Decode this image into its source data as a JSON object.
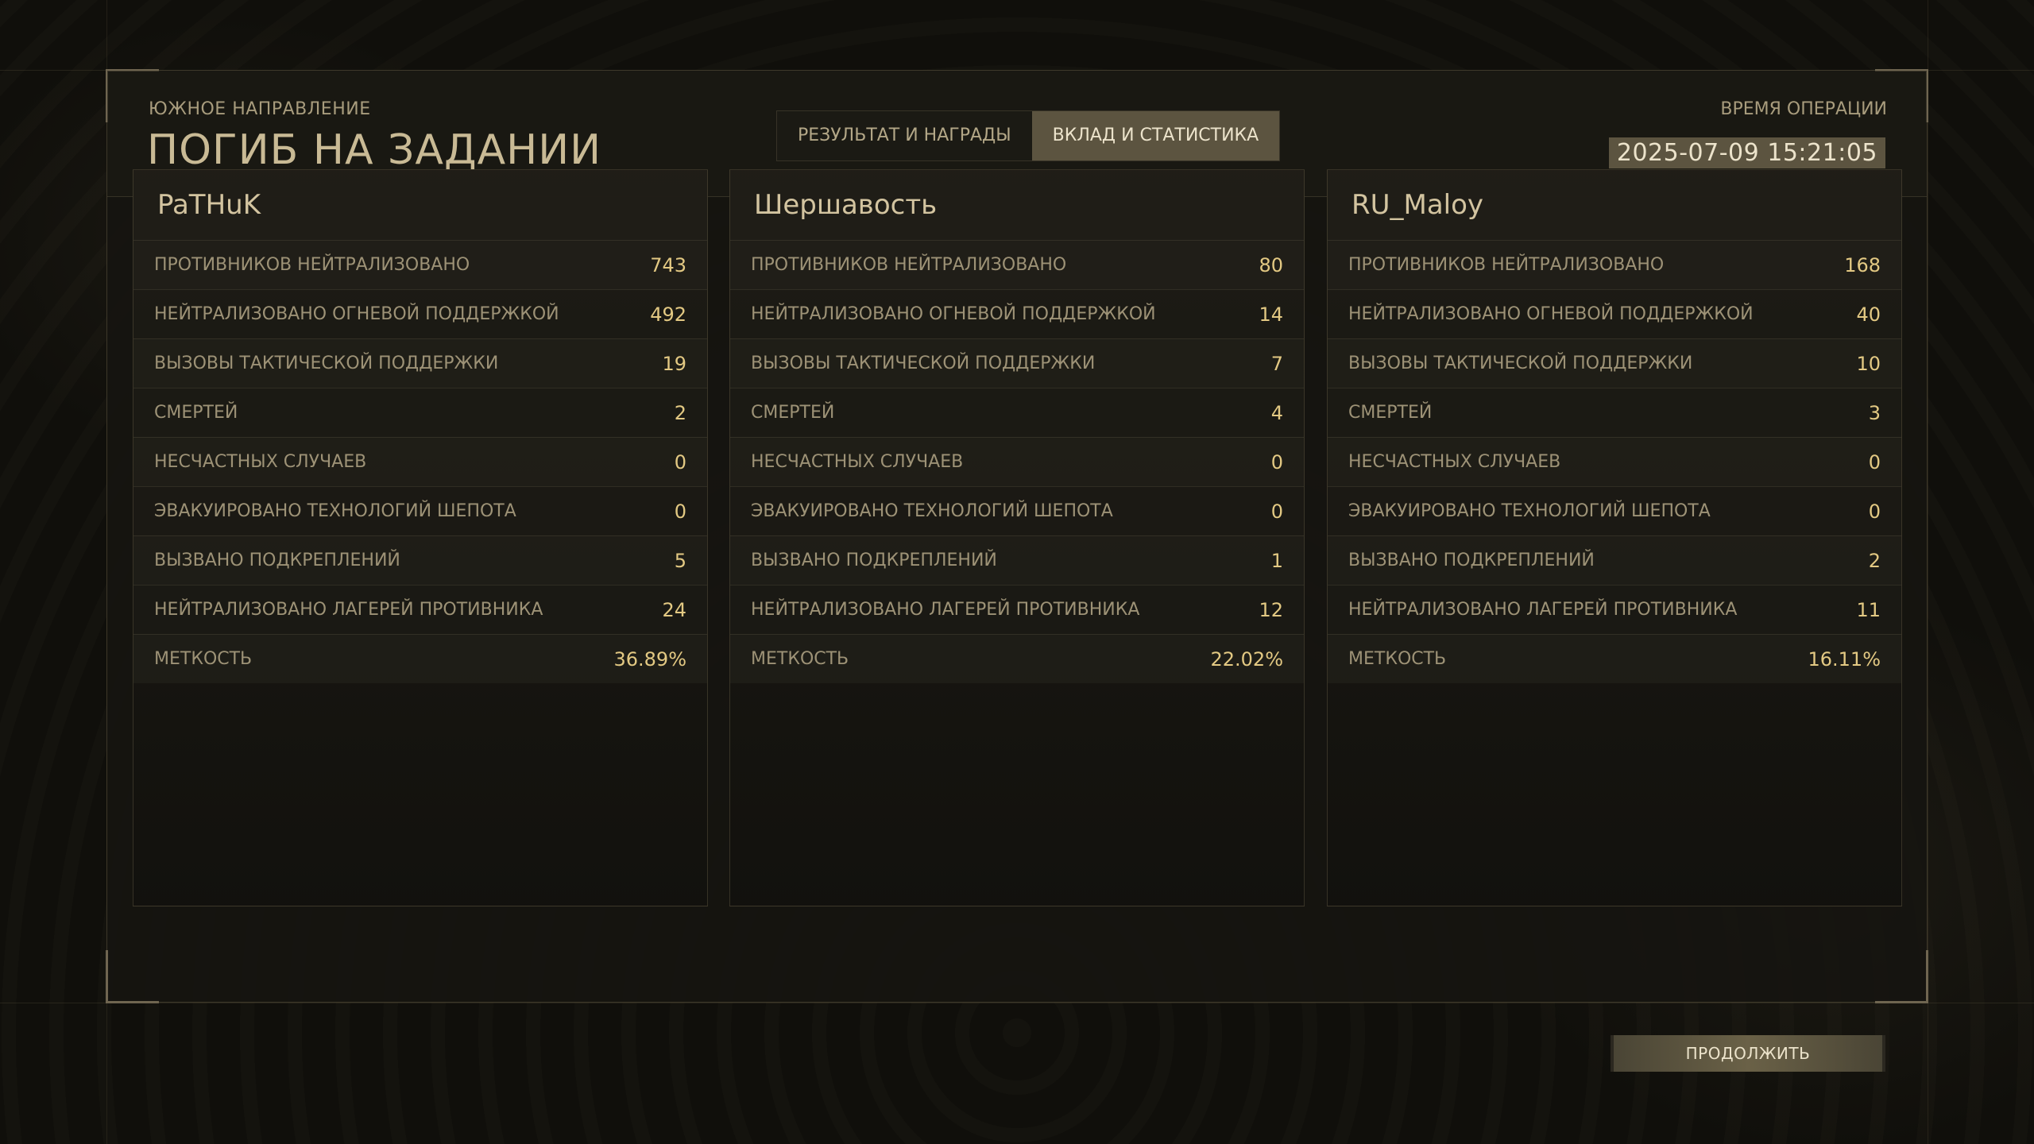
{
  "header": {
    "subtitle": "ЮЖНОЕ НАПРАВЛЕНИЕ",
    "title": "ПОГИБ НА ЗАДАНИИ",
    "tabs": [
      {
        "label": "РЕЗУЛЬТАТ И НАГРАДЫ",
        "active": false
      },
      {
        "label": "ВКЛАД И СТАТИСТИКА",
        "active": true
      }
    ],
    "operation_time_label": "ВРЕМЯ ОПЕРАЦИИ",
    "operation_time_value": "2025-07-09 15:21:05"
  },
  "stat_labels": [
    "ПРОТИВНИКОВ НЕЙТРАЛИЗОВАНО",
    "НЕЙТРАЛИЗОВАНО ОГНЕВОЙ ПОДДЕРЖКОЙ",
    "ВЫЗОВЫ ТАКТИЧЕСКОЙ ПОДДЕРЖКИ",
    "СМЕРТЕЙ",
    "НЕСЧАСТНЫХ СЛУЧАЕВ",
    "ЭВАКУИРОВАНО ТЕХНОЛОГИЙ ШЕПОТА",
    "ВЫЗВАНО ПОДКРЕПЛЕНИЙ",
    "НЕЙТРАЛИЗОВАНО ЛАГЕРЕЙ ПРОТИВНИКА",
    "МЕТКОСТЬ"
  ],
  "players": [
    {
      "name": "PaTHuK",
      "values": [
        "743",
        "492",
        "19",
        "2",
        "0",
        "0",
        "5",
        "24",
        "36.89%"
      ]
    },
    {
      "name": "Шершавость",
      "values": [
        "80",
        "14",
        "7",
        "4",
        "0",
        "0",
        "1",
        "12",
        "22.02%"
      ]
    },
    {
      "name": "RU_Maloy",
      "values": [
        "168",
        "40",
        "10",
        "3",
        "0",
        "0",
        "2",
        "11",
        "16.11%"
      ]
    }
  ],
  "footer": {
    "continue_label": "ПРОДОЛЖИТЬ"
  },
  "colors": {
    "accent": "#5c5440",
    "value": "#e3c983",
    "text": "#9d9276"
  }
}
